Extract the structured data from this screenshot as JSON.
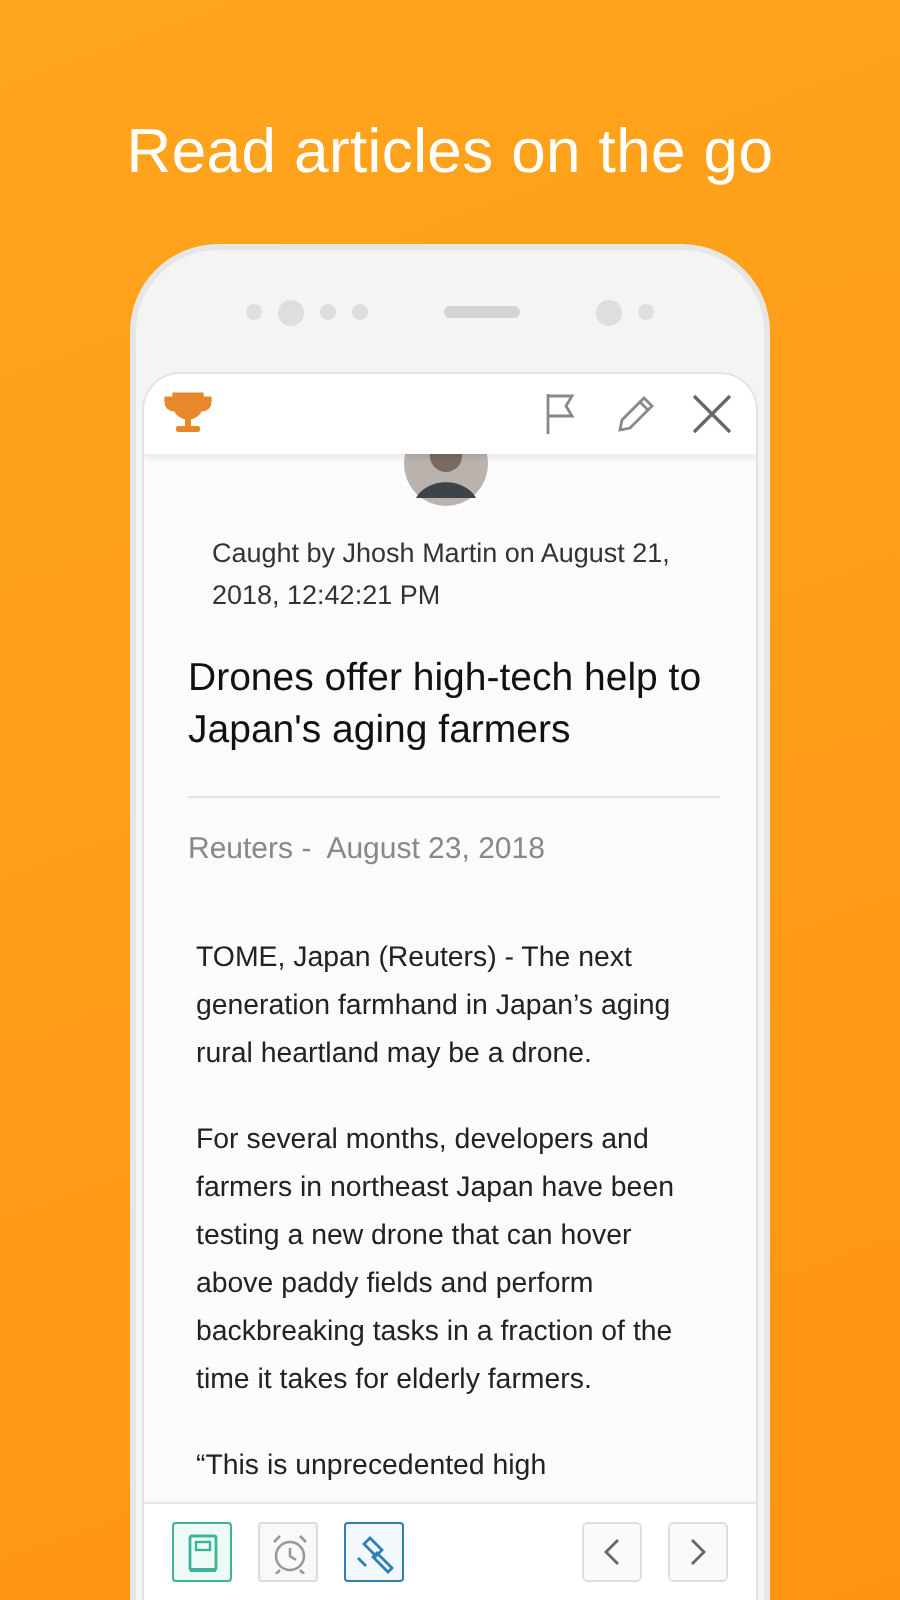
{
  "headline": "Read articles on the go",
  "top_bar": {
    "icons": [
      {
        "kind": "trophy"
      },
      {
        "kind": "flag"
      },
      {
        "kind": "pencil"
      },
      {
        "kind": "close"
      }
    ]
  },
  "article": {
    "caught_by": "Caught by Jhosh Martin on August 21, 2018, 12:42:21 PM",
    "title": "Drones offer high-tech help to Japan's aging farmers",
    "source": "Reuters -  August 23, 2018",
    "paragraphs": [
      "TOME, Japan (Reuters) - The next generation farmhand in Japan’s aging rural heartland may be a drone.",
      "For several months, developers and farmers in northeast Japan have been testing a new drone that can hover above paddy fields and perform backbreaking tasks in a fraction of the time it takes for elderly farmers.",
      "“This is unprecedented high"
    ]
  },
  "toolbar": {
    "tools": [
      {
        "kind": "book",
        "selected": true
      },
      {
        "kind": "alarm",
        "selected": false
      },
      {
        "kind": "gavel",
        "selected": true
      }
    ],
    "nav": [
      {
        "kind": "previous"
      },
      {
        "kind": "next"
      }
    ]
  }
}
